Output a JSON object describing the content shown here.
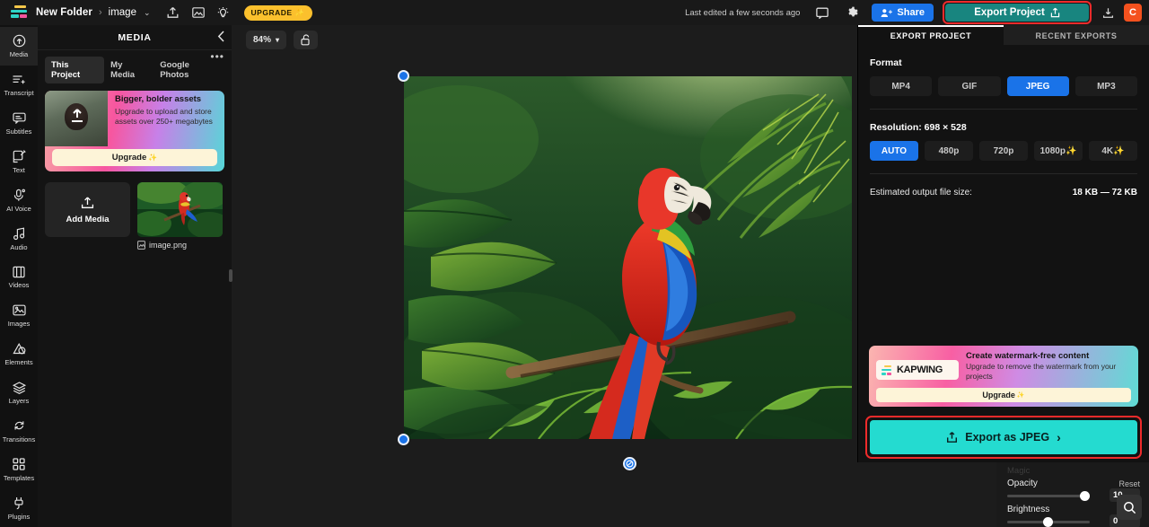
{
  "topbar": {
    "breadcrumb_root": "New Folder",
    "breadcrumb_sep": "›",
    "breadcrumb_current": "image",
    "chevron": "⌄",
    "upgrade_pill": "UPGRADE",
    "last_edited": "Last edited a few seconds ago",
    "share_label": "Share",
    "export_label": "Export Project",
    "avatar_initial": "C",
    "icons": {
      "upload": "upload-icon",
      "gallery": "gallery-icon",
      "lightbulb": "lightbulb-icon",
      "comment": "comment-icon",
      "settings": "gear-icon",
      "download": "download-icon"
    }
  },
  "rail": {
    "items": [
      {
        "label": "Media",
        "icon": "media-icon",
        "active": true
      },
      {
        "label": "Transcript",
        "icon": "transcript-icon",
        "active": false
      },
      {
        "label": "Subtitles",
        "icon": "subtitles-icon",
        "active": false
      },
      {
        "label": "Text",
        "icon": "text-icon",
        "active": false
      },
      {
        "label": "AI Voice",
        "icon": "ai-voice-icon",
        "active": false
      },
      {
        "label": "Audio",
        "icon": "audio-icon",
        "active": false
      },
      {
        "label": "Videos",
        "icon": "videos-icon",
        "active": false
      },
      {
        "label": "Images",
        "icon": "images-icon",
        "active": false
      },
      {
        "label": "Elements",
        "icon": "elements-icon",
        "active": false
      },
      {
        "label": "Layers",
        "icon": "layers-icon",
        "active": false
      },
      {
        "label": "Transitions",
        "icon": "transitions-icon",
        "active": false
      },
      {
        "label": "Templates",
        "icon": "templates-icon",
        "active": false
      },
      {
        "label": "Plugins",
        "icon": "plugins-icon",
        "active": false
      }
    ]
  },
  "media_panel": {
    "title": "MEDIA",
    "collapse_icon": "chevron-left-icon",
    "overflow_icon": "more-options-icon",
    "tabs": [
      {
        "label": "This Project",
        "active": true
      },
      {
        "label": "My Media",
        "active": false
      },
      {
        "label": "Google Photos",
        "active": false
      }
    ],
    "promo": {
      "heading": "Bigger, bolder assets",
      "body": "Upgrade to upload and store assets over 250+ megabytes",
      "button": "Upgrade",
      "sparkle": "✨"
    },
    "add_media_label": "Add Media",
    "asset_name": "image.png",
    "asset_icon": "image-file-icon"
  },
  "stage": {
    "zoom_level": "84%",
    "zoom_chevron": "⌄",
    "lock_icon": "unlock-icon",
    "rotate_icon": "rotate-handle-icon"
  },
  "export_panel": {
    "tabs": [
      {
        "label": "EXPORT PROJECT",
        "active": true
      },
      {
        "label": "RECENT EXPORTS",
        "active": false
      }
    ],
    "format_label": "Format",
    "formats": [
      {
        "label": "MP4",
        "selected": false
      },
      {
        "label": "GIF",
        "selected": false
      },
      {
        "label": "JPEG",
        "selected": true
      },
      {
        "label": "MP3",
        "selected": false
      }
    ],
    "resolution_label": "Resolution: 698 × 528",
    "resolutions": [
      {
        "label": "AUTO",
        "selected": true
      },
      {
        "label": "480p",
        "selected": false
      },
      {
        "label": "720p",
        "selected": false
      },
      {
        "label": "1080p✨",
        "selected": false
      },
      {
        "label": "4K✨",
        "selected": false
      }
    ],
    "filesize_label": "Estimated output file size:",
    "filesize_value": "18 KB — 72 KB",
    "watermark_card": {
      "logo_text": "KAPWING",
      "heading": "Create watermark-free content",
      "body": "Upgrade to remove the watermark from your projects",
      "button": "Upgrade",
      "sparkle": "✨"
    },
    "export_cta": "Export as JPEG",
    "export_cta_arrow": "›",
    "export_cta_icon": "share-export-icon"
  },
  "adjust_panel": {
    "ghost_label": "Magic",
    "opacity_label": "Opacity",
    "opacity_reset": "Reset",
    "opacity_value": "10",
    "brightness_label": "Brightness",
    "brightness_value": "0",
    "search_icon": "search-icon"
  },
  "colors": {
    "accent_blue": "#1a73e8",
    "export_teal": "#18857f",
    "cta_teal": "#24dbd0",
    "highlight_red": "#ef2b2b",
    "upgrade_yellow": "#fbc02d",
    "avatar_orange": "#f4511e"
  }
}
